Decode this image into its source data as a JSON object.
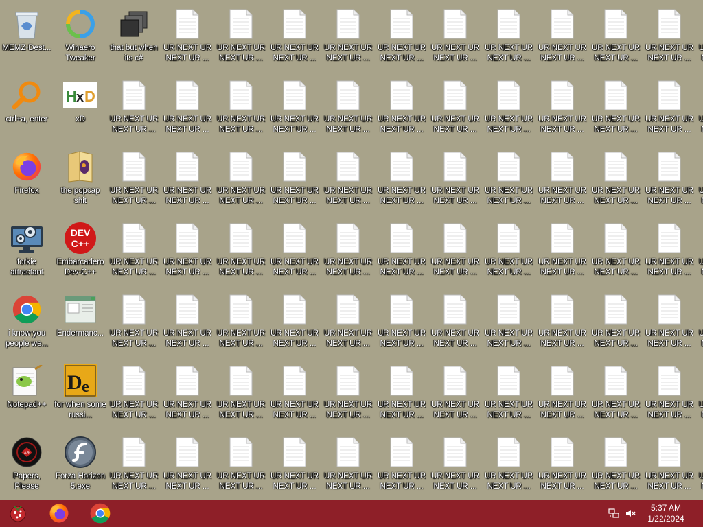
{
  "desktop": {
    "background": "#a8a38a",
    "fixed_icons": [
      {
        "col": 0,
        "row": 0,
        "label": "MEMZ-Dest...",
        "icon": "recycle-bin-icon"
      },
      {
        "col": 1,
        "row": 0,
        "label": "Winaero Tweaker",
        "icon": "winaero-icon"
      },
      {
        "col": 2,
        "row": 0,
        "label": "that but when its c#",
        "icon": "stacked-windows-icon"
      },
      {
        "col": 0,
        "row": 1,
        "label": "ctrl+a, enter",
        "icon": "magnifier-icon"
      },
      {
        "col": 1,
        "row": 1,
        "label": "xD",
        "icon": "hxd-icon"
      },
      {
        "col": 0,
        "row": 2,
        "label": "Firefox",
        "icon": "firefox-icon"
      },
      {
        "col": 1,
        "row": 2,
        "label": "the popcap shit",
        "icon": "folder-icon"
      },
      {
        "col": 0,
        "row": 3,
        "label": "forkie attractant",
        "icon": "monitor-gear-icon"
      },
      {
        "col": 1,
        "row": 3,
        "label": "Embarcadero Dev-C++",
        "icon": "devcpp-icon"
      },
      {
        "col": 0,
        "row": 4,
        "label": "i know you people we...",
        "icon": "chrome-icon"
      },
      {
        "col": 1,
        "row": 4,
        "label": "Endermanc...",
        "icon": "window-app-icon"
      },
      {
        "col": 0,
        "row": 5,
        "label": "Notepad++",
        "icon": "notepadpp-icon"
      },
      {
        "col": 1,
        "row": 5,
        "label": "for when some russi...",
        "icon": "de-icon"
      },
      {
        "col": 0,
        "row": 6,
        "label": "Papers, Please",
        "icon": "papers-please-icon"
      },
      {
        "col": 1,
        "row": 6,
        "label": "Forza Horizon 5.exe",
        "icon": "flash-icon"
      }
    ],
    "file_label": "UR NEXT UR NEXT UR ...",
    "file_icon": "text-file-icon"
  },
  "taskbar": {
    "color": "#8e1f28",
    "pinned": [
      {
        "name": "start-button",
        "icon": "start-orb-icon"
      },
      {
        "name": "taskbar-firefox",
        "icon": "firefox-icon"
      },
      {
        "name": "taskbar-chrome",
        "icon": "chrome-icon"
      }
    ],
    "tray": {
      "network_icon": "network-icon",
      "volume_icon": "volume-muted-icon",
      "time": "5:37 AM",
      "date": "1/22/2024"
    }
  }
}
